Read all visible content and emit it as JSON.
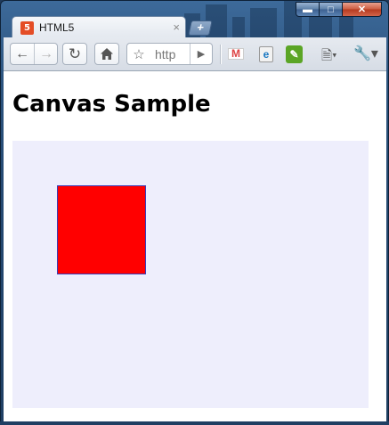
{
  "browser": {
    "tab": {
      "title": "HTML5",
      "favicon": "html5-icon"
    },
    "toolbar": {
      "url_text": "http",
      "icons": [
        "back-icon",
        "forward-icon",
        "reload-icon",
        "home-icon",
        "star-icon",
        "go-icon",
        "gmail-icon",
        "ie-icon",
        "evernote-icon",
        "page-menu-icon",
        "wrench-icon"
      ]
    }
  },
  "page": {
    "heading": "Canvas Sample",
    "canvas": {
      "background": "#eeeefc",
      "shape": {
        "type": "rect",
        "fill": "#ff0000",
        "stroke": "#3b3bb5"
      }
    }
  }
}
